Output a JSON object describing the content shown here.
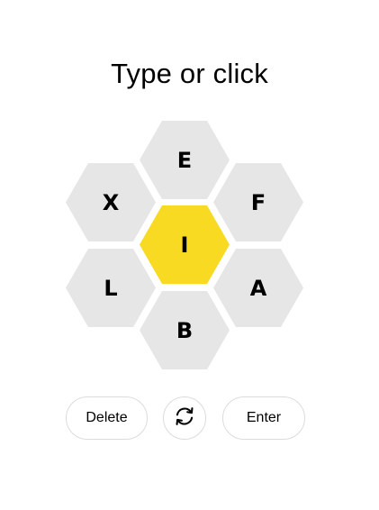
{
  "prompt": "Type or click",
  "hive": {
    "center_letter": "I",
    "outer_letters": [
      "E",
      "F",
      "A",
      "B",
      "L",
      "X"
    ]
  },
  "controls": {
    "delete_label": "Delete",
    "shuffle_icon": "shuffle-icon",
    "enter_label": "Enter"
  },
  "colors": {
    "center": "#f7da21",
    "outer": "#e6e6e6",
    "button_border": "#dcdcdc"
  }
}
